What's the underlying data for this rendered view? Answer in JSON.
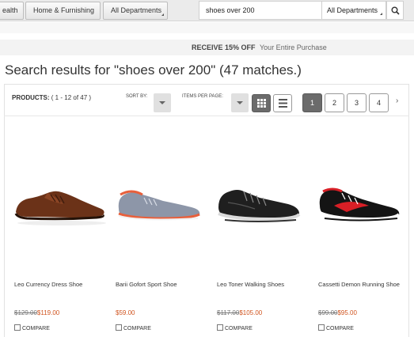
{
  "top_nav": {
    "tabs": [
      {
        "label": "ealth"
      },
      {
        "label": "Home & Furnishing"
      },
      {
        "label": "All Departments"
      }
    ],
    "search": {
      "value": "shoes over 200",
      "department": "All Departments"
    }
  },
  "promo": {
    "bold": "RECEIVE 15% OFF",
    "rest": "Your Entire Purchase"
  },
  "results": {
    "heading": "Search results for \"shoes over 200\" (47 matches.)",
    "products_label": "PRODUCTS:",
    "range": "( 1 - 12 of 47 )",
    "sort_label": "SORT BY:",
    "items_per_page_label": "ITEMS PER PAGE:",
    "view": "grid",
    "pages": [
      "1",
      "2",
      "3",
      "4"
    ],
    "current_page": "1",
    "next": "›"
  },
  "products": [
    {
      "name": "Leo Currency Dress Shoe",
      "old_price": "$129.00",
      "new_price": "$119.00",
      "compare": "COMPARE",
      "icon": "brown-dress-shoe"
    },
    {
      "name": "Barii Gofort Sport Shoe",
      "old_price": "",
      "new_price": "$59.00",
      "compare": "COMPARE",
      "icon": "grey-sport-shoe"
    },
    {
      "name": "Leo Toner Walking Shoes",
      "old_price": "$117.00",
      "new_price": "$105.00",
      "compare": "COMPARE",
      "icon": "black-walking-shoe"
    },
    {
      "name": "Cassetti Demon Running Shoe",
      "old_price": "$99.00",
      "new_price": "$95.00",
      "compare": "COMPARE",
      "icon": "black-red-running-shoe"
    }
  ]
}
